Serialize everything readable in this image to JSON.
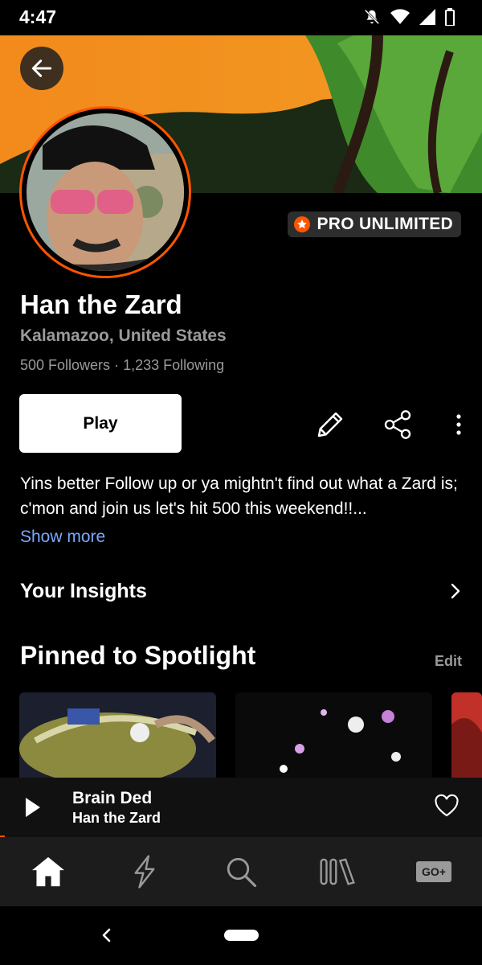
{
  "status_bar": {
    "time": "4:47",
    "icons": [
      "notifications-off-icon",
      "wifi-icon",
      "signal-icon",
      "battery-icon"
    ]
  },
  "profile": {
    "name": "Han the Zard",
    "location": "Kalamazoo, United States",
    "followers": "500 Followers",
    "separator": "·",
    "following": "1,233 Following",
    "badge": "PRO UNLIMITED",
    "bio": "Yins better Follow up or ya mightn't find out what a Zard is; c'mon and join us let's hit 500 this weekend!!...",
    "show_more": "Show more"
  },
  "actions": {
    "play_label": "Play",
    "icons": [
      "edit-icon",
      "share-icon",
      "more-options-icon"
    ]
  },
  "insights": {
    "label": "Your Insights"
  },
  "spotlight": {
    "title": "Pinned to Spotlight",
    "edit_label": "Edit"
  },
  "mini_player": {
    "track_title": "Brain Ded",
    "artist": "Han the Zard",
    "progress_fraction": 0.01
  },
  "bottom_nav": {
    "items": [
      "home-icon",
      "stream-icon",
      "search-icon",
      "library-icon",
      "go-plus-icon"
    ],
    "go_plus_label": "GO+"
  },
  "colors": {
    "accent": "#ff5500",
    "link": "#7aa8ff",
    "muted": "#9a9a9a",
    "background": "#000000"
  }
}
